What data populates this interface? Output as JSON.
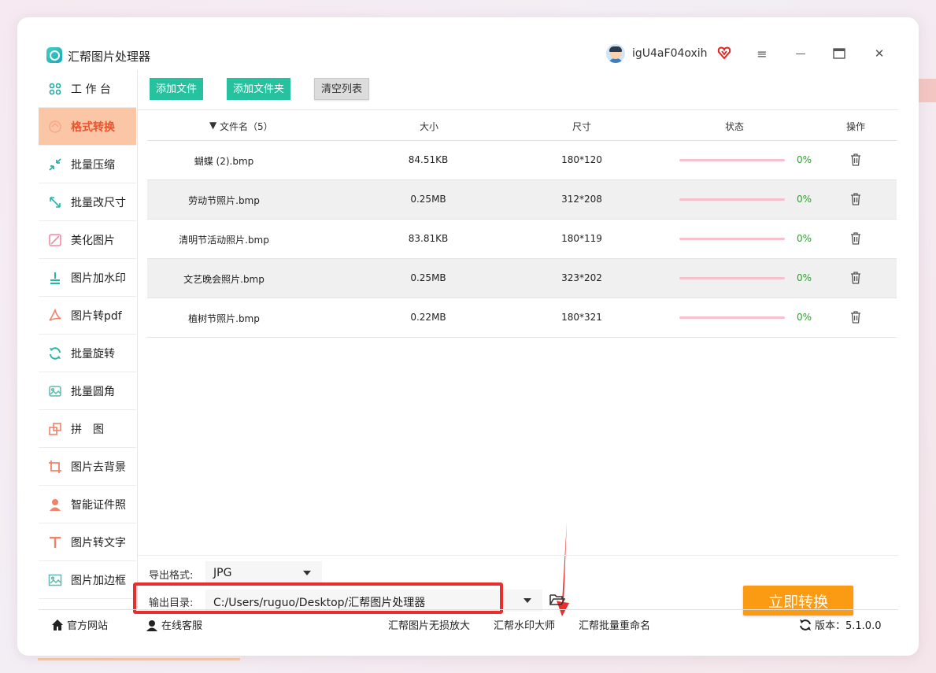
{
  "app": {
    "title": "汇帮图片处理器",
    "username": "igU4aF04oxih"
  },
  "window_controls": {
    "menu": "≡",
    "minimize": "—",
    "maximize": "▭",
    "close": "✕"
  },
  "sidebar": {
    "items": [
      {
        "label": "工 作 台",
        "icon": "grid-icon"
      },
      {
        "label": "格式转换",
        "icon": "convert-icon",
        "active": true
      },
      {
        "label": "批量压缩",
        "icon": "compress-icon"
      },
      {
        "label": "批量改尺寸",
        "icon": "resize-icon"
      },
      {
        "label": "美化图片",
        "icon": "beautify-icon"
      },
      {
        "label": "图片加水印",
        "icon": "watermark-icon"
      },
      {
        "label": "图片转pdf",
        "icon": "pdf-icon"
      },
      {
        "label": "批量旋转",
        "icon": "rotate-icon"
      },
      {
        "label": "批量圆角",
        "icon": "round-corner-icon"
      },
      {
        "label": "拼　图",
        "icon": "puzzle-icon"
      },
      {
        "label": "图片去背景",
        "icon": "crop-icon"
      },
      {
        "label": "智能证件照",
        "icon": "person-icon"
      },
      {
        "label": "图片转文字",
        "icon": "text-icon"
      },
      {
        "label": "图片加边框",
        "icon": "frame-icon"
      }
    ]
  },
  "toolbar": {
    "add_file": "添加文件",
    "add_folder": "添加文件夹",
    "clear_list": "清空列表"
  },
  "table": {
    "headers": {
      "name": "文件名（5）",
      "size": "大小",
      "dims": "尺寸",
      "status": "状态",
      "action": "操作"
    },
    "rows": [
      {
        "name": "蝴蝶 (2).bmp",
        "size": "84.51KB",
        "dims": "180*120",
        "progress": "0%"
      },
      {
        "name": "劳动节照片.bmp",
        "size": "0.25MB",
        "dims": "312*208",
        "progress": "0%"
      },
      {
        "name": "清明节活动照片.bmp",
        "size": "83.81KB",
        "dims": "180*119",
        "progress": "0%"
      },
      {
        "name": "文艺晚会照片.bmp",
        "size": "0.25MB",
        "dims": "323*202",
        "progress": "0%"
      },
      {
        "name": "植树节照片.bmp",
        "size": "0.22MB",
        "dims": "180*321",
        "progress": "0%"
      }
    ]
  },
  "export": {
    "format_label": "导出格式:",
    "format_value": "JPG",
    "dir_label": "输出目录:",
    "dir_value": "C:/Users/ruguo/Desktop/汇帮图片处理器",
    "convert_button": "立即转换"
  },
  "footer": {
    "website": "官方网站",
    "service": "在线客服",
    "link1": "汇帮图片无损放大",
    "link2": "汇帮水印大师",
    "link3": "汇帮批量重命名",
    "version": "版本：5.1.0.0"
  },
  "colors": {
    "accent": "#26c2a0",
    "active_bg": "#fbc6a6",
    "active_text": "#e8542d",
    "convert": "#fb9b13",
    "highlight": "#e82f2c"
  }
}
